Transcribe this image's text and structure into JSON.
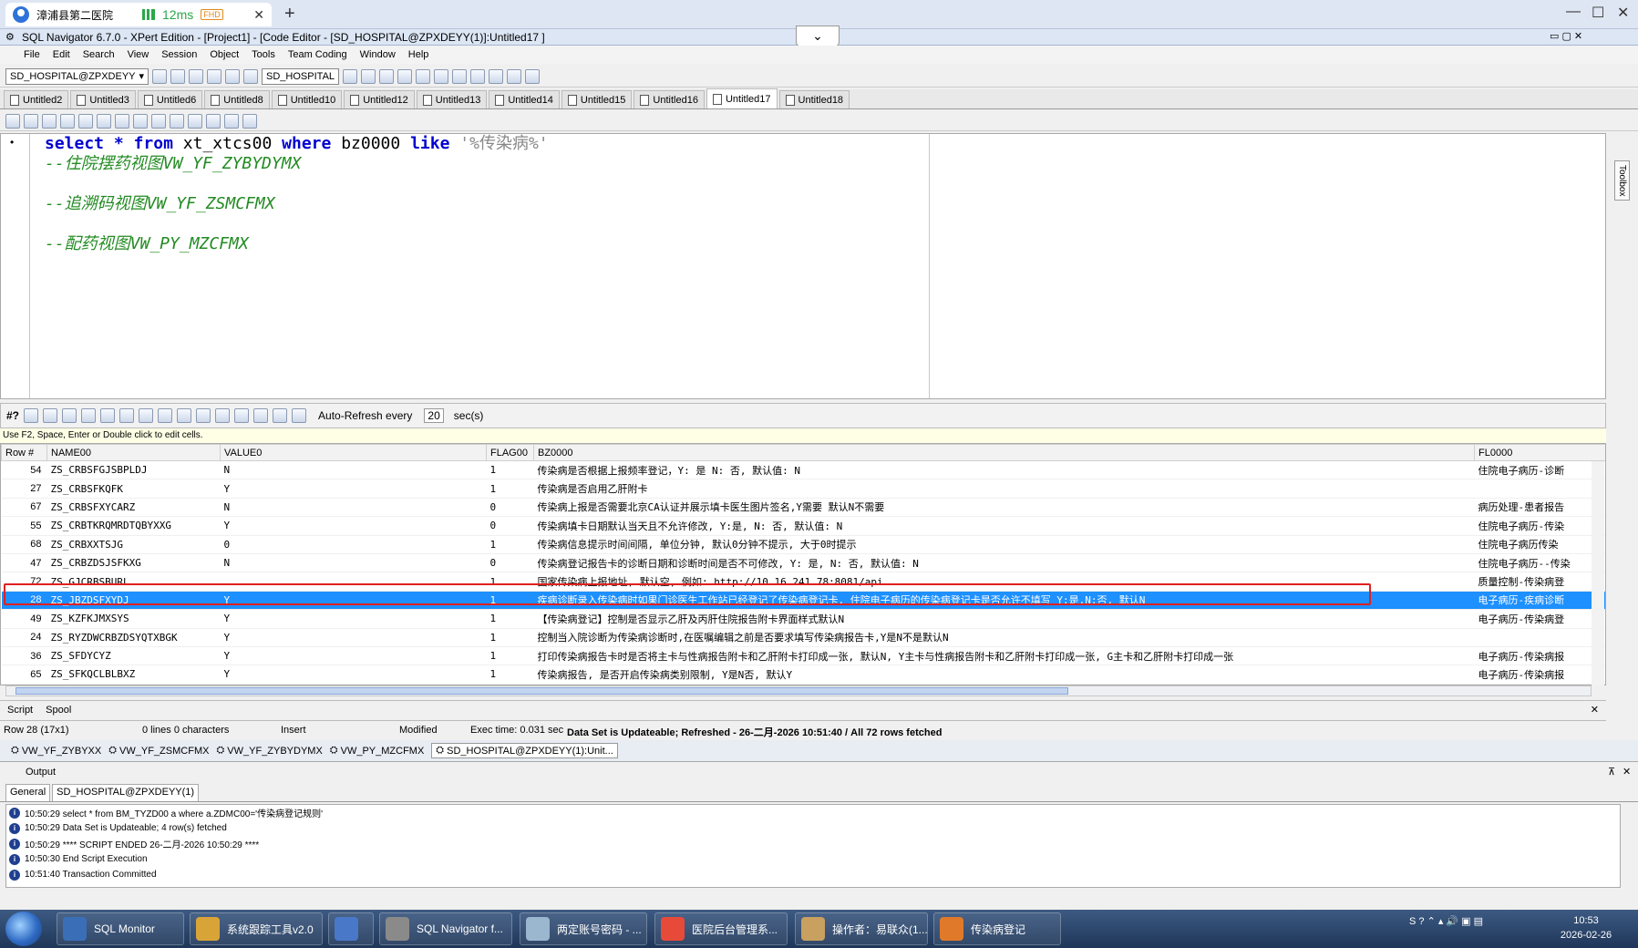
{
  "browser": {
    "tab_title": "漳浦县第二医院",
    "latency": "12ms",
    "quality": "FHD"
  },
  "app": {
    "title": "SQL Navigator 6.7.0 - XPert Edition - [Project1] - [Code Editor - [SD_HOSPITAL@ZPXDEYY(1)]:Untitled17 ]"
  },
  "menu": [
    "File",
    "Edit",
    "Search",
    "View",
    "Session",
    "Object",
    "Tools",
    "Team Coding",
    "Window",
    "Help"
  ],
  "toolbar": {
    "connection": "SD_HOSPITAL@ZPXDEYY",
    "schema": "SD_HOSPITAL"
  },
  "doc_tabs": [
    "Untitled2",
    "Untitled3",
    "Untitled6",
    "Untitled8",
    "Untitled10",
    "Untitled12",
    "Untitled13",
    "Untitled14",
    "Untitled15",
    "Untitled16",
    "Untitled17",
    "Untitled18"
  ],
  "active_tab": "Untitled17",
  "editor": {
    "line1_select": "select",
    "line1_star": "*",
    "line1_from": "from",
    "line1_table": "xt_xtcs00",
    "line1_where": "where",
    "line1_col": "bz0000",
    "line1_like": "like",
    "line1_str": "'%传染病%'",
    "comment1": "--住院摆药视图VW_YF_ZYBYDYMX",
    "comment2": "--追溯码视图VW_YF_ZSMCFMX",
    "comment3": "--配药视图VW_PY_MZCFMX"
  },
  "toolbox_label": "Toolbox",
  "grid": {
    "label": "#?",
    "auto_refresh_label": "Auto-Refresh every",
    "auto_refresh_value": "20",
    "auto_refresh_unit": "sec(s)",
    "hint": "Use F2, Space, Enter or Double click to edit cells.",
    "columns": [
      "Row #",
      "NAME00",
      "VALUE0",
      "FLAG00",
      "BZ0000",
      "FL0000"
    ],
    "rows": [
      {
        "n": "54",
        "name": "ZS_CRBSFGJSBPLDJ",
        "val": "N",
        "flag": "1",
        "bz": "传染病是否根据上报频率登记，Y: 是 N: 否, 默认值: N",
        "fl": "住院电子病历-诊断"
      },
      {
        "n": "27",
        "name": "ZS_CRBSFKQFK",
        "val": "Y",
        "flag": "1",
        "bz": "传染病是否启用乙肝附卡",
        "fl": ""
      },
      {
        "n": "67",
        "name": "ZS_CRBSFXYCARZ",
        "val": "N",
        "flag": "0",
        "bz": "传染病上报是否需要北京CA认证并展示填卡医生图片签名,Y需要 默认N不需要",
        "fl": "病历处理-患者报告"
      },
      {
        "n": "55",
        "name": "ZS_CRBTKRQMRDTQBYXXG",
        "val": "Y",
        "flag": "0",
        "bz": "传染病填卡日期默认当天且不允许修改, Y:是, N: 否, 默认值: N",
        "fl": "住院电子病历-传染"
      },
      {
        "n": "68",
        "name": "ZS_CRBXXTSJG",
        "val": "0",
        "flag": "1",
        "bz": "传染病信息提示时间间隔, 单位分钟, 默认0分钟不提示, 大于0时提示",
        "fl": "住院电子病历传染"
      },
      {
        "n": "47",
        "name": "ZS_CRBZDSJSFKXG",
        "val": "N",
        "flag": "0",
        "bz": "传染病登记报告卡的诊断日期和诊断时间是否不可修改, Y: 是, N: 否, 默认值: N",
        "fl": "住院电子病历--传染"
      },
      {
        "n": "72",
        "name": "ZS_GJCRBSBURL",
        "val": "",
        "flag": "1",
        "bz": "国家传染病上报地址, 默认空, 例如: http://10.16.241.78:8081/api",
        "fl": "质量控制-传染病登"
      },
      {
        "n": "28",
        "name": "ZS_JBZDSFXYDJ",
        "val": "Y",
        "flag": "1",
        "bz": "疾病诊断录入传染病时如果门诊医生工作站已经登记了传染病登记卡, 住院电子病历的传染病登记卡是否允许不填写  Y:是,N:否, 默认N",
        "fl": "电子病历-疾病诊断"
      },
      {
        "n": "49",
        "name": "ZS_KZFKJMXSYS",
        "val": "Y",
        "flag": "1",
        "bz": "【传染病登记】控制是否显示乙肝及丙肝住院报告附卡界面样式默认N",
        "fl": "电子病历-传染病登"
      },
      {
        "n": "24",
        "name": "ZS_RYZDWCRBZDSYQTXBGK",
        "val": "Y",
        "flag": "1",
        "bz": "控制当入院诊断为传染病诊断时,在医嘱编辑之前是否要求填写传染病报告卡,Y是N不是默认N",
        "fl": ""
      },
      {
        "n": "36",
        "name": "ZS_SFDYCYZ",
        "val": "Y",
        "flag": "1",
        "bz": "打印传染病报告卡时是否将主卡与性病报告附卡和乙肝附卡打印成一张, 默认N, Y主卡与性病报告附卡和乙肝附卡打印成一张, G主卡和乙肝附卡打印成一张",
        "fl": "电子病历-传染病报"
      },
      {
        "n": "65",
        "name": "ZS_SFKQCLBLBXZ",
        "val": "Y",
        "flag": "1",
        "bz": "传染病报告, 是否开启传染病类别限制, Y是N否, 默认Y",
        "fl": "电子病历-传染病报"
      }
    ],
    "selected_row": "28"
  },
  "scriptbar": {
    "script": "Script",
    "spool": "Spool"
  },
  "status": {
    "row": "Row 28 (17x1)",
    "lines": "0 lines 0 characters",
    "mode": "Insert",
    "modified": "Modified",
    "exec": "Exec time: 0.031 sec",
    "message": "Data Set is Updateable; Refreshed - 26-二月-2026 10:51:40 / All 72 rows fetched"
  },
  "object_tabs": [
    "VW_YF_ZYBYXX",
    "VW_YF_ZSMCFMX",
    "VW_YF_ZYBYDYMX",
    "VW_PY_MZCFMX",
    "SD_HOSPITAL@ZPXDEYY(1):Unit..."
  ],
  "output": {
    "title": "Output",
    "tabs": [
      "General",
      "SD_HOSPITAL@ZPXDEYY(1)"
    ],
    "lines": [
      "10:50:29  select * from BM_TYZD00 a where a.ZDMC00='传染病登记规则'",
      "10:50:29  Data Set is Updateable; 4 row(s) fetched",
      "10:50:29  **** SCRIPT ENDED 26-二月-2026 10:50:29 ****",
      "10:50:30  End Script Execution",
      "10:51:40  Transaction Committed"
    ]
  },
  "taskbar": {
    "items": [
      "SQL Monitor",
      "系统跟踪工具v2.0",
      "",
      "SQL Navigator f...",
      "两定账号密码 - ...",
      "医院后台管理系...",
      "操作者：易联众(1...",
      "传染病登记"
    ],
    "time": "10:53",
    "date": "2026-02-26"
  }
}
